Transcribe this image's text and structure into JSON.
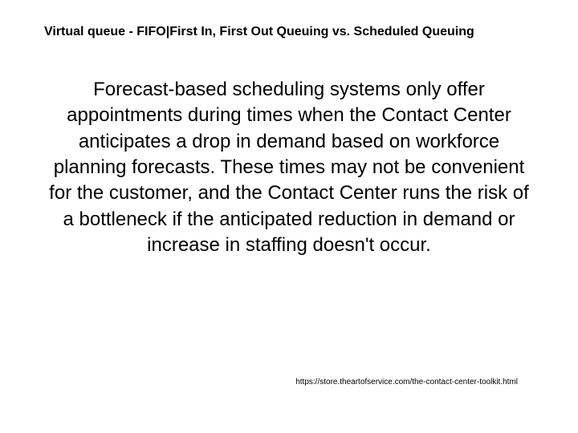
{
  "slide": {
    "title": "Virtual queue - FIFO|First In, First Out Queuing vs. Scheduled Queuing",
    "body": "Forecast-based scheduling systems only offer appointments during times when the Contact Center anticipates a drop in demand based on workforce planning forecasts. These times may not be convenient for the customer, and the Contact Center runs the risk of a bottleneck if the anticipated reduction in demand or increase in staffing doesn't occur.",
    "footer_url": "https://store.theartofservice.com/the-contact-center-toolkit.html"
  }
}
